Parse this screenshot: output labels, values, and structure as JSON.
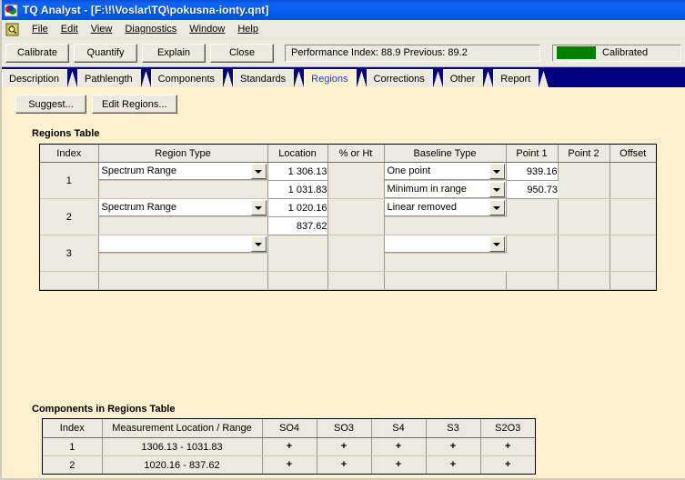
{
  "window": {
    "title": "TQ Analyst  - [F:\\!\\Voslar\\TQ\\pokusna-ionty.qnt]",
    "app_icon": "tq-analyst-icon"
  },
  "menu": {
    "doc_icon": "document-icon",
    "items": [
      "File",
      "Edit",
      "View",
      "Diagnostics",
      "Window",
      "Help"
    ]
  },
  "toolbar": {
    "buttons": [
      "Calibrate",
      "Quantify",
      "Explain",
      "Close"
    ],
    "performance": "Performance Index:  88.9  Previous:  89.2",
    "performance_index": "88.9",
    "previous_index": "89.2",
    "status_label": "Calibrated",
    "status_color": "#008000"
  },
  "tabs": [
    {
      "label": "Description",
      "active": false
    },
    {
      "label": "Pathlength",
      "active": false
    },
    {
      "label": "Components",
      "active": false
    },
    {
      "label": "Standards",
      "active": false
    },
    {
      "label": "Regions",
      "active": true
    },
    {
      "label": "Corrections",
      "active": false
    },
    {
      "label": "Other",
      "active": false
    },
    {
      "label": "Report",
      "active": false
    }
  ],
  "page_buttons": [
    "Suggest...",
    "Edit Regions..."
  ],
  "regions": {
    "title": "Regions Table",
    "columns": [
      "Index",
      "Region Type",
      "Location",
      "% or Ht",
      "Baseline Type",
      "Point 1",
      "Point 2",
      "Offset"
    ],
    "rows": [
      {
        "index": "1",
        "region_type": "Spectrum Range",
        "location_start": "1 306.13",
        "location_end": "1 031.83",
        "pct_or_ht": "",
        "baseline_type_1": "One point",
        "baseline_type_2": "Minimum in range",
        "point1_a": "939.16",
        "point1_b": "950.73",
        "point2": "",
        "offset": ""
      },
      {
        "index": "2",
        "region_type": "Spectrum Range",
        "location_start": "1 020.16",
        "location_end": "837.62",
        "pct_or_ht": "",
        "baseline_type_1": "Linear removed",
        "baseline_type_2": "",
        "point1_a": "",
        "point1_b": "",
        "point2": "",
        "offset": ""
      },
      {
        "index": "3",
        "region_type": "",
        "location_start": "",
        "location_end": "",
        "pct_or_ht": "",
        "baseline_type_1": "",
        "baseline_type_2": "",
        "point1_a": "",
        "point1_b": "",
        "point2": "",
        "offset": ""
      }
    ]
  },
  "components": {
    "title": "Components in Regions Table",
    "columns": [
      "Index",
      "Measurement Location / Range",
      "SO4",
      "SO3",
      "S4",
      "S3",
      "S2O3"
    ],
    "rows": [
      {
        "index": "1",
        "range": "1306.13 - 1031.83",
        "marks": [
          "+",
          "+",
          "+",
          "+",
          "+"
        ]
      },
      {
        "index": "2",
        "range": "1020.16 - 837.62",
        "marks": [
          "+",
          "+",
          "+",
          "+",
          "+"
        ]
      }
    ]
  }
}
